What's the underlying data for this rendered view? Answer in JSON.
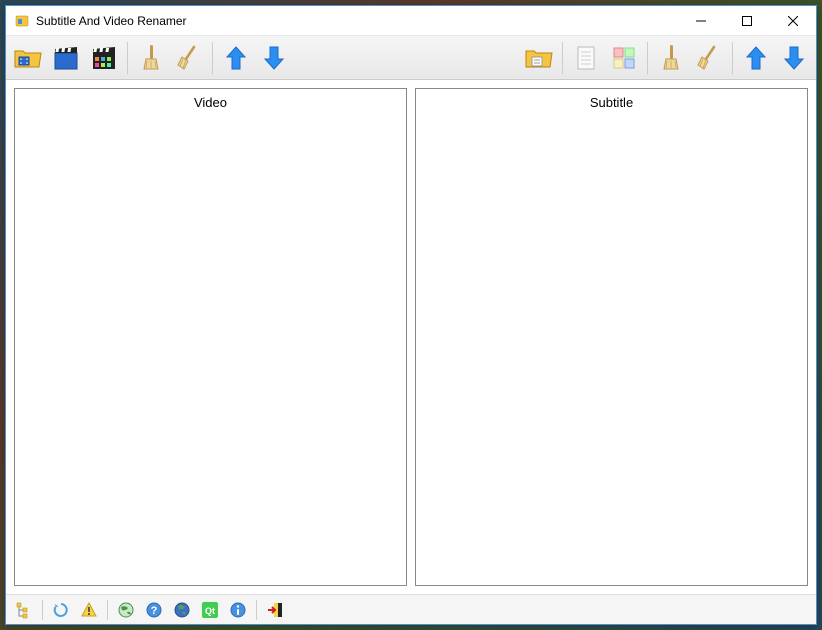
{
  "window": {
    "title": "Subtitle And Video Renamer"
  },
  "panels": {
    "video_header": "Video",
    "subtitle_header": "Subtitle"
  },
  "toolbar_left": {
    "icons": [
      "folder-video",
      "clapper-blue",
      "clapper-color",
      "brush-clean",
      "broom",
      "arrow-up",
      "arrow-down"
    ]
  },
  "toolbar_right": {
    "icons": [
      "folder-subtitle",
      "document",
      "color-squares",
      "brush-clean",
      "broom",
      "arrow-up",
      "arrow-down"
    ]
  },
  "bottom_toolbar": {
    "icons": [
      "tree",
      "refresh",
      "warning",
      "globe",
      "help",
      "earth",
      "qt",
      "info",
      "exit"
    ]
  },
  "colors": {
    "accent_blue": "#1e90ff",
    "arrow_blue": "#2a8ff0",
    "folder_yellow": "#f5c542",
    "broom_brown": "#c49a4a"
  }
}
